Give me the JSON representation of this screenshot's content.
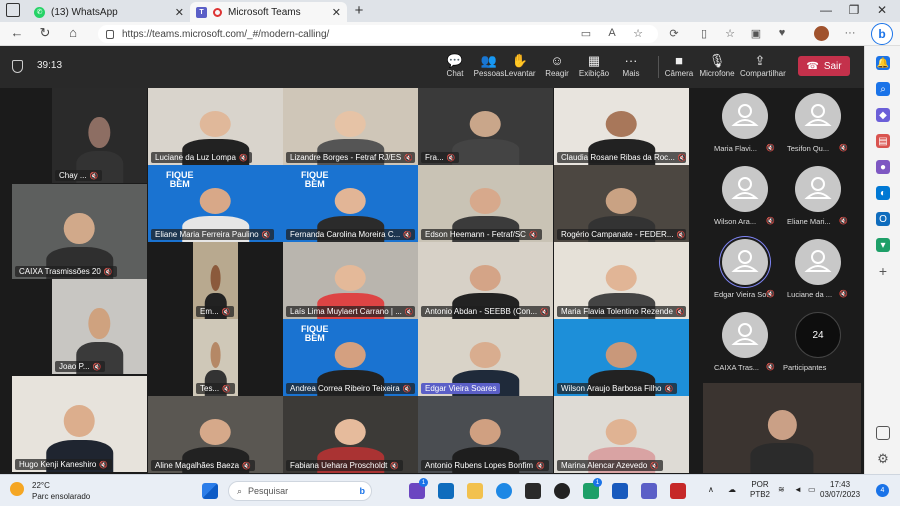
{
  "browser": {
    "tabs": [
      {
        "title": "(13) WhatsApp",
        "icon": "whatsapp-icon",
        "active": false
      },
      {
        "title": "Microsoft Teams",
        "icon": "teams-icon",
        "active": true
      }
    ],
    "url": "https://teams.microsoft.com/_#/modern-calling/"
  },
  "meeting": {
    "timer": "39:13",
    "toolbar": [
      {
        "label": "Chat",
        "icon": "chat-icon",
        "glyph": "💬"
      },
      {
        "label": "Pessoas",
        "icon": "people-icon",
        "glyph": "👥"
      },
      {
        "label": "Levantar",
        "icon": "raise-hand-icon",
        "glyph": "✋"
      },
      {
        "label": "Reagir",
        "icon": "react-icon",
        "glyph": "☺"
      },
      {
        "label": "Exibição",
        "icon": "view-icon",
        "glyph": "▦"
      },
      {
        "label": "Mais",
        "icon": "more-icon",
        "glyph": "···"
      },
      {
        "label": "Câmera",
        "icon": "camera-icon",
        "glyph": "■"
      },
      {
        "label": "Microfone",
        "icon": "mic-off-icon",
        "glyph": "🎙"
      },
      {
        "label": "Compartilhar",
        "icon": "share-icon",
        "glyph": "⇪"
      }
    ],
    "leave_label": "Sair"
  },
  "tiles": [
    {
      "name": "Chay ...",
      "bg": "#2a2a2a",
      "skin": "#8d6e63",
      "shirt": "#333"
    },
    {
      "name": "Luciane da Luz Lompa",
      "bg": "#d9d4cc",
      "skin": "#e0b89a",
      "shirt": "#222"
    },
    {
      "name": "Lizandre Borges - Fetraf RJ/ES",
      "bg": "#cfc6b8",
      "skin": "#e6c3a6",
      "shirt": "#555"
    },
    {
      "name": "Fra...",
      "bg": "#3a3a3a",
      "skin": "#c9a68a",
      "shirt": "#444"
    },
    {
      "name": "Claudia Rosane Ribas da Roc...",
      "bg": "#e8e4de",
      "skin": "#a8775a",
      "shirt": "#222"
    },
    {
      "name": "CAIXA Trasmissões 20",
      "bg": "#5d5f5e",
      "skin": "#d1a98a",
      "shirt": "#2f2f2f"
    },
    {
      "name": "Eliane Maria Ferreira Paulino",
      "bg": "#1a73d1",
      "skin": "#d8a888",
      "shirt": "#e6e6e6",
      "fique_bem": true
    },
    {
      "name": "Fernanda Carolina Moreira C...",
      "bg": "#1a73d1",
      "skin": "#e2b596",
      "shirt": "#2b2b2b",
      "fique_bem": true
    },
    {
      "name": "Edson Heemann - Fetraf/SC",
      "bg": "#c9c3b5",
      "skin": "#d7a98c",
      "shirt": "#3b3b3b"
    },
    {
      "name": "Rogério Campanate - FEDER...",
      "bg": "#4c4741",
      "skin": "#c9a283",
      "shirt": "#333"
    },
    {
      "name": "Em...",
      "bg": "#b8a98f",
      "skin": "#8b5a3c",
      "shirt": "#222"
    },
    {
      "name": "Laís Lima Muylaert Carrano | ...",
      "bg": "#b9b5ae",
      "skin": "#e4b999",
      "shirt": "#d44"
    },
    {
      "name": "Antonio Abdan - SEEBB (Con...",
      "bg": "#d7d1c7",
      "skin": "#d4a487",
      "shirt": "#222"
    },
    {
      "name": "Maria Flavia Tolentino Rezende",
      "bg": "#e6e1d8",
      "skin": "#e1b596",
      "shirt": "#444"
    },
    {
      "name": "Joao P...",
      "bg": "#c8c6c2",
      "skin": "#cfa27f",
      "shirt": "#3a3a3a"
    },
    {
      "name": "Tes...",
      "bg": "#cfc8b8",
      "skin": "#b58866",
      "shirt": "#333"
    },
    {
      "name": "Andrea Correa Ribeiro Teixeira",
      "bg": "#1a73d1",
      "skin": "#d4a080",
      "shirt": "#222",
      "fique_bem": true
    },
    {
      "name": "Edgar Vieira Soares",
      "bg": "#d9d3c8",
      "skin": "#d9ad8f",
      "shirt": "#1f2a3a",
      "speaking": true
    },
    {
      "name": "Wilson Araujo Barbosa Filho",
      "bg": "#1d8fd9",
      "skin": "#c9987a",
      "shirt": "#222"
    },
    {
      "name": "Hugo Kenji Kaneshiro",
      "bg": "#e7e3dc",
      "skin": "#dcae8d",
      "shirt": "#1f2530"
    },
    {
      "name": "Aline Magalhães Baeza",
      "bg": "#5a5752",
      "skin": "#d6a98a",
      "shirt": "#222"
    },
    {
      "name": "Fabiana Uehara Proscholdt",
      "bg": "#3c3a37",
      "skin": "#e6bb9c",
      "shirt": "#a33"
    },
    {
      "name": "Antonio Rubens Lopes Bonfim",
      "bg": "#4a4d51",
      "skin": "#d0a081",
      "shirt": "#1e1e1e"
    },
    {
      "name": "Marina Alencar Azevedo",
      "bg": "#dedbd5",
      "skin": "#e0b393",
      "shirt": "#d9a3a3"
    }
  ],
  "fique_bem_text": "FIQUE\nBEM",
  "participants": [
    {
      "name": "Maria Flavi..."
    },
    {
      "name": "Tesifon Qu..."
    },
    {
      "name": "Wilson Ara..."
    },
    {
      "name": "Eliane Mari..."
    },
    {
      "name": "Edgar Vieira So...",
      "active": true
    },
    {
      "name": "Luciane da ..."
    },
    {
      "name": "CAIXA Tras..."
    }
  ],
  "participants_more": {
    "count": "24",
    "label": "Participantes"
  },
  "taskbar": {
    "weather_temp": "22°C",
    "weather_cond": "Parc ensolarado",
    "search_placeholder": "Pesquisar",
    "lang": "POR",
    "layout": "PTB2",
    "time": "17:43",
    "date": "03/07/2023",
    "notif_count": "4"
  },
  "colors": {
    "leave": "#c4314b",
    "teams_accent": "#5b5fc7"
  }
}
